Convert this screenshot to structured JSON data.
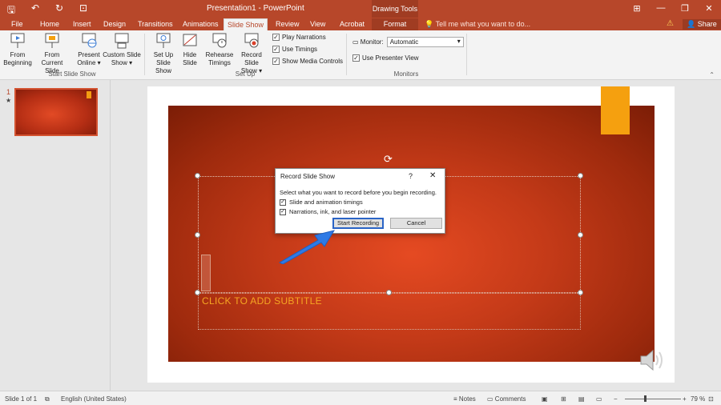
{
  "app": {
    "window_title": "Presentation1 - PowerPoint",
    "context_tab_group": "Drawing Tools"
  },
  "tabs": [
    "File",
    "Home",
    "Insert",
    "Design",
    "Transitions",
    "Animations",
    "Slide Show",
    "Review",
    "View",
    "Acrobat",
    "Format"
  ],
  "tell_me": "Tell me what you want to do...",
  "share": "Share",
  "ribbon": {
    "start_group": "Start Slide Show",
    "from_beginning": [
      "From",
      "Beginning"
    ],
    "from_current": [
      "From",
      "Current Slide"
    ],
    "present_online": [
      "Present",
      "Online ▾"
    ],
    "custom_show": [
      "Custom Slide",
      "Show ▾"
    ],
    "setup_group": "Set Up",
    "setup_show": [
      "Set Up",
      "Slide Show"
    ],
    "hide_slide": [
      "Hide",
      "Slide"
    ],
    "rehearse": [
      "Rehearse",
      "Timings"
    ],
    "record": [
      "Record Slide",
      "Show ▾"
    ],
    "play_narrations": "Play Narrations",
    "use_timings": "Use Timings",
    "show_media": "Show Media Controls",
    "monitors_group": "Monitors",
    "monitor_label": "Monitor:",
    "monitor_value": "Automatic",
    "presenter_view": "Use Presenter View"
  },
  "slide_panel": {
    "number": "1",
    "star": "★"
  },
  "slide": {
    "subtitle_placeholder": "CLICK TO ADD SUBTITLE"
  },
  "dialog": {
    "title": "Record Slide Show",
    "help": "?",
    "close": "✕",
    "prompt": "Select what you want to record before you begin recording.",
    "option1": "Slide and animation timings",
    "option2": "Narrations, ink, and laser pointer",
    "start_button": "Start Recording",
    "cancel_button": "Cancel"
  },
  "status": {
    "slide_info": "Slide 1 of 1",
    "language": "English (United States)",
    "notes": "Notes",
    "comments": "Comments",
    "zoom": "79 %"
  },
  "colors": {
    "accent": "#b7472a",
    "slide_orange": "#e54a22",
    "tag_orange": "#f5a00f",
    "arrow_blue": "#2f7ae5"
  }
}
